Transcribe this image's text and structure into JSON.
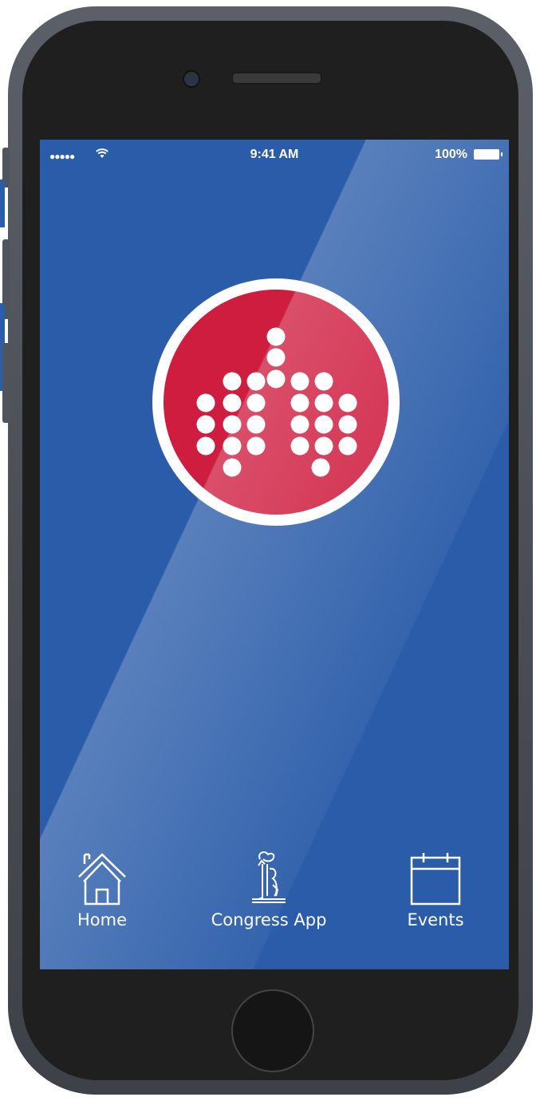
{
  "status_bar": {
    "signal": "●●●●●",
    "time": "9:41 AM",
    "battery": "100%"
  },
  "app": {
    "logo_icon": "lungs-dots-icon",
    "colors": {
      "background": "#2a5ca9",
      "logo": "#cf1d3f",
      "text": "#ffffff"
    }
  },
  "tabs": [
    {
      "label": "Home",
      "icon": "home-icon"
    },
    {
      "label": "Congress App",
      "icon": "congress-statue-icon"
    },
    {
      "label": "Events",
      "icon": "calendar-icon"
    }
  ]
}
